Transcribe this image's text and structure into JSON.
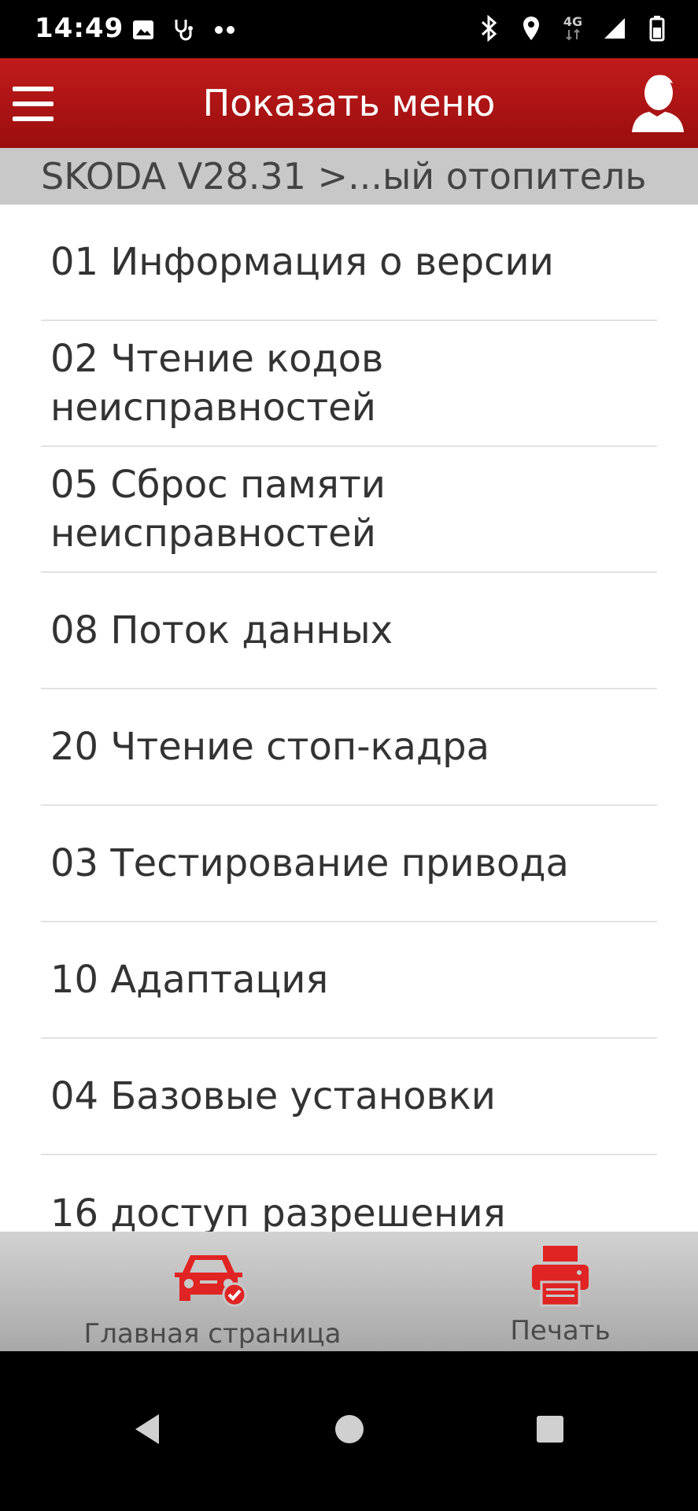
{
  "status_bar": {
    "time": "14:49",
    "left_icons": [
      "image-icon",
      "stethoscope-icon",
      "more-dots-icon"
    ],
    "right_icons": [
      "bluetooth-icon",
      "location-icon",
      "network-4g-icon",
      "signal-icon",
      "battery-icon"
    ],
    "network_label": "4G"
  },
  "app_bar": {
    "title": "Показать меню",
    "menu_icon": "hamburger-icon",
    "user_icon": "user-icon",
    "color": "#b01414"
  },
  "breadcrumb": "SKODA V28.31 >...ый отопитель",
  "menu_items": [
    "01 Информация о версии",
    "02 Чтение кодов неисправностей",
    "05 Сброс памяти неисправностей",
    "08 Поток данных",
    "20 Чтение стоп-кадра",
    "03 Тестирование привода",
    "10 Адаптация",
    "04 Базовые установки",
    "16 доступ разрешения"
  ],
  "bottom_bar": {
    "home_label": "Главная страница",
    "home_icon": "car-check-icon",
    "print_label": "Печать",
    "print_icon": "printer-icon",
    "accent": "#e02424"
  },
  "nav_bar": {
    "icons": [
      "back-icon",
      "home-icon",
      "recents-icon"
    ]
  }
}
